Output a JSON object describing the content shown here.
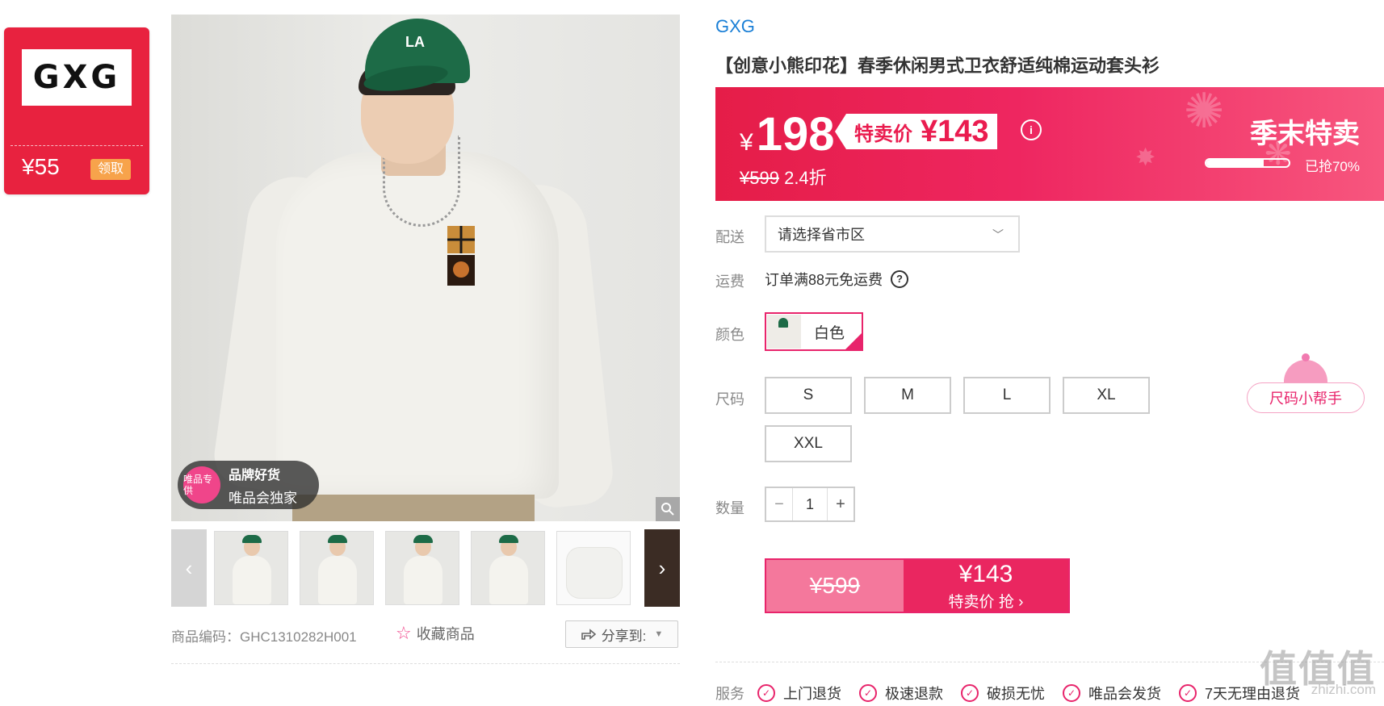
{
  "coupon": {
    "logo_text": "GXG",
    "amount": "¥55",
    "claim_label": "领取"
  },
  "gallery": {
    "badge_circle": "唯品专供",
    "badge_title": "品牌好货",
    "badge_sub": "唯品会独家",
    "zoom_icon": "search-icon",
    "prev_icon": "chevron-left-icon",
    "next_icon": "chevron-right-icon"
  },
  "product": {
    "code_label": "商品编码：GHC1310282H001",
    "favorite_label": "收藏商品",
    "share_label": "分享到:",
    "brand": "GXG",
    "title": "【创意小熊印花】春季休闲男式卫衣舒适纯棉运动套头衫"
  },
  "price": {
    "currency": "¥",
    "main": "198",
    "special_label": "特卖价",
    "special_value": "¥143",
    "original": "¥599",
    "discount": "2.4折",
    "event": "季末特卖",
    "sold_percent": 70,
    "sold_label": "已抢70%"
  },
  "options": {
    "delivery_label": "配送",
    "delivery_placeholder": "请选择省市区",
    "freight_label": "运费",
    "freight_text": "订单满88元免运费",
    "color_label": "颜色",
    "color_value": "白色",
    "size_label": "尺码",
    "sizes": [
      "S",
      "M",
      "L",
      "XL",
      "XXL"
    ],
    "size_helper": "尺码小帮手",
    "qty_label": "数量",
    "qty_value": "1",
    "qty_minus": "−",
    "qty_plus": "+"
  },
  "buy": {
    "original": "¥599",
    "price": "¥143",
    "action": "特卖价 抢 ›"
  },
  "services": {
    "label": "服务",
    "items": [
      "上门退货",
      "极速退款",
      "破损无忧",
      "唯品会发货",
      "7天无理由退货"
    ]
  },
  "watermark": {
    "text": "值值值",
    "url": "zhizhi.com"
  },
  "colors": {
    "accent": "#e8246b",
    "brand_link": "#1a7fd6",
    "coupon_red": "#e8223f"
  }
}
